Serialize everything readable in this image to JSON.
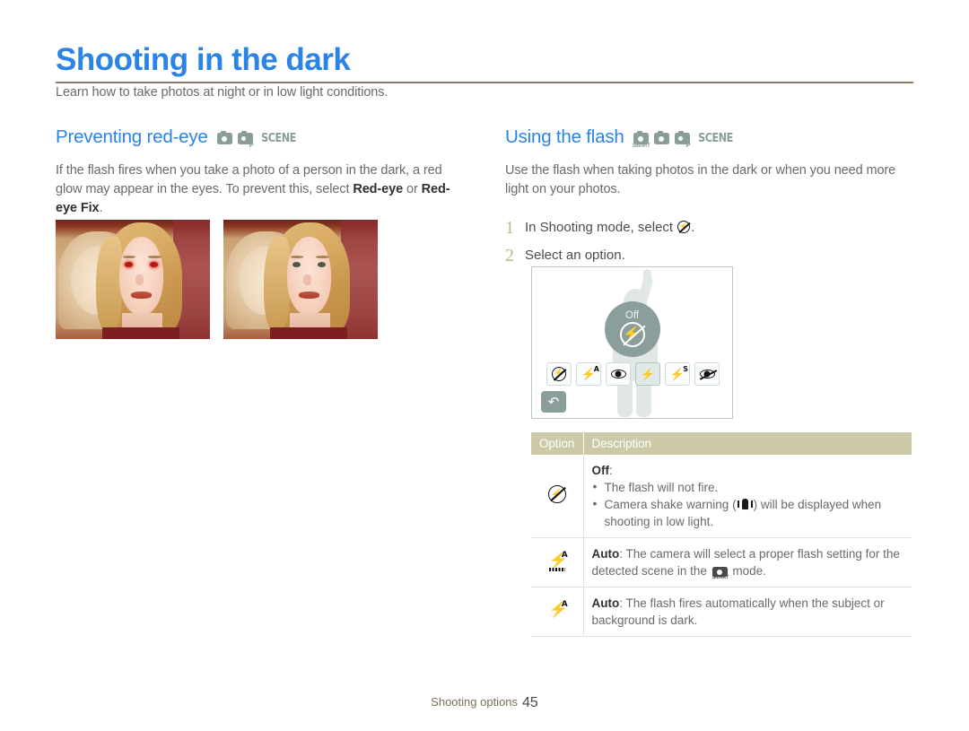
{
  "page": {
    "title": "Shooting in the dark",
    "intro": "Learn how to take photos at night or in low light conditions.",
    "title_color": "#2b83e8",
    "rule_color": "#8a7f66"
  },
  "left_section": {
    "heading": "Preventing red-eye",
    "mode_icons": [
      "camera-icon",
      "program-icon",
      "scene-icon"
    ],
    "scene_label": "SCENE",
    "program_label": "P",
    "body_parts": [
      {
        "text": "If the flash fires when you take a photo of a person in the dark, a red glow may appear in the eyes. To prevent this, select ",
        "bold": false
      },
      {
        "text": "Red-eye",
        "bold": true
      },
      {
        "text": " or ",
        "bold": false
      },
      {
        "text": "Red-eye Fix",
        "bold": true
      },
      {
        "text": ".",
        "bold": false
      }
    ],
    "photos": [
      {
        "name": "photo-with-red-eye",
        "eye_state": "red"
      },
      {
        "name": "photo-without-red-eye",
        "eye_state": "normal"
      }
    ]
  },
  "right_section": {
    "heading": "Using the flash",
    "mode_icons": [
      "smart-auto-icon",
      "camera-icon",
      "program-icon",
      "scene-icon"
    ],
    "smart_label": "SMART",
    "scene_label": "SCENE",
    "program_label": "P",
    "body": "Use the flash when taking photos in the dark or when you need more light on your photos.",
    "steps": [
      {
        "num": "1",
        "before": "In Shooting mode, select ",
        "after": "."
      },
      {
        "num": "2",
        "before": "Select an option.",
        "after": ""
      }
    ],
    "step_num_color": "#aec08f"
  },
  "lcd": {
    "badge_label": "Off",
    "badge_color": "#8a9e9b",
    "back_glyph": "↶",
    "options": [
      {
        "name": "flash-off-option",
        "icon": "flash-off-icon",
        "selected": false
      },
      {
        "name": "auto-flash-smart-option",
        "icon": "flash-auto-icon",
        "sup": "A",
        "selected": false
      },
      {
        "name": "red-eye-option",
        "icon": "eye-icon",
        "selected": false
      },
      {
        "name": "fill-in-option",
        "icon": "flash-icon",
        "selected": true
      },
      {
        "name": "slow-sync-option",
        "icon": "flash-slow-icon",
        "sup": "S",
        "selected": false
      },
      {
        "name": "red-eye-fix-option",
        "icon": "eye-slash-icon",
        "selected": false
      }
    ]
  },
  "table": {
    "header_bg": "#ccc9a8",
    "columns": [
      "Option",
      "Description"
    ],
    "rows": [
      {
        "icon": "flash-off-icon",
        "title": "Off",
        "title_suffix": ":",
        "bullets": [
          {
            "pre": "The flash will not fire.",
            "post": ""
          },
          {
            "pre": "Camera shake warning (",
            "mid_icon": "camera-shake-icon",
            "post": ") will be displayed when shooting in low light."
          }
        ]
      },
      {
        "icon": "flash-auto-smart-icon",
        "title": "Auto",
        "text_before": ": The camera will select a proper flash setting for the detected scene in the ",
        "inline_icon": "smart-auto-icon",
        "text_after": " mode."
      },
      {
        "icon": "flash-auto-icon",
        "title": "Auto",
        "text_before": ": The flash fires automatically when the subject or background is dark.",
        "text_after": ""
      }
    ]
  },
  "footer": {
    "label": "Shooting options",
    "page_number": "45"
  }
}
